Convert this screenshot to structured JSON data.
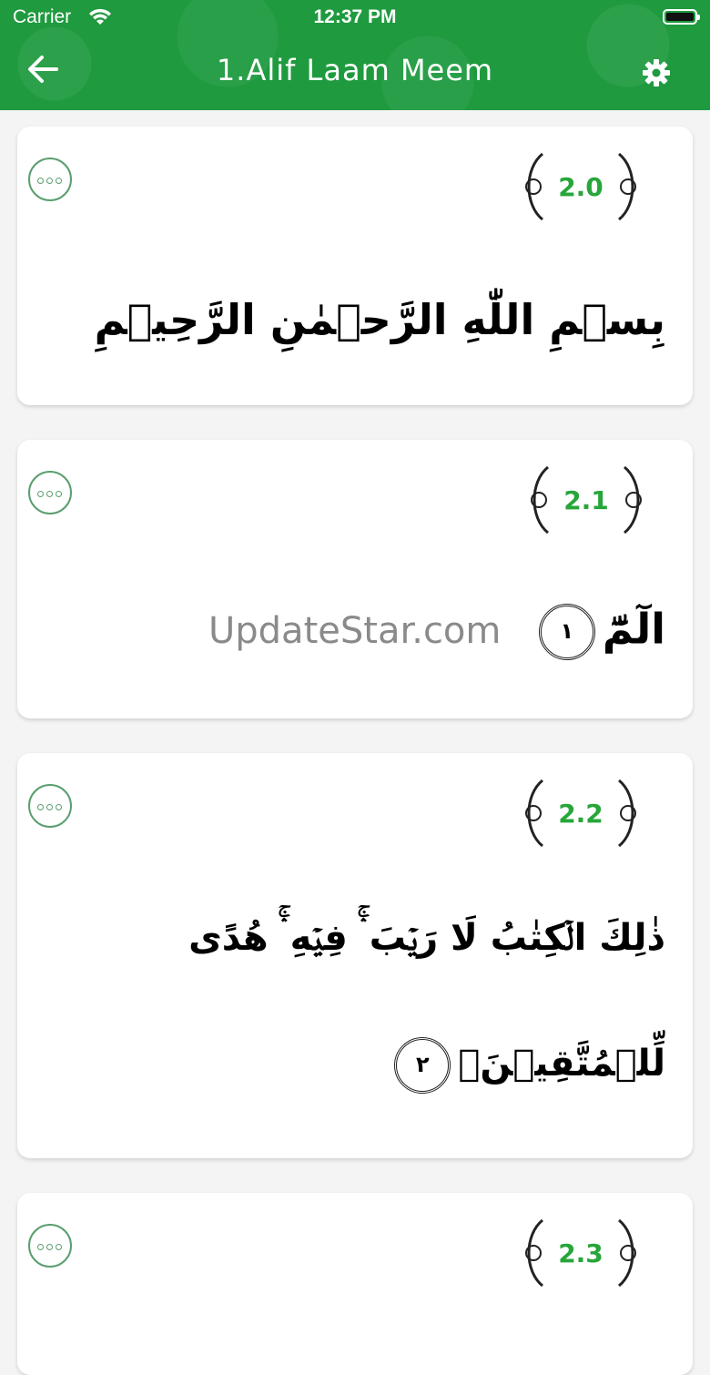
{
  "status_bar": {
    "carrier": "Carrier",
    "time": "12:37 PM"
  },
  "header": {
    "title": "1.Alif Laam Meem",
    "back_icon": "arrow-left-icon",
    "settings_icon": "gear-icon"
  },
  "colors": {
    "header_green": "#1f9a3f",
    "ayah_number_green": "#27a63a",
    "more_button_outline": "#5a9e6f"
  },
  "verses": [
    {
      "number": "2.0",
      "line1": "بِسۡمِ اللّٰهِ الرَّحۡمٰنِ الرَّحِيۡمِ",
      "line2": "",
      "ayah_mark": ""
    },
    {
      "number": "2.1",
      "line1": "الٓمّٓ",
      "line2": "",
      "ayah_mark": "١"
    },
    {
      "number": "2.2",
      "line1": "ذٰلِكَ الۡكِتٰبُ لَا رَيۡبَ ۛۚ فِيۡهِ ۛۚ هُدًى",
      "line2": "لِّلۡمُتَّقِيۡنَۙ",
      "ayah_mark": "٢"
    },
    {
      "number": "2.3"
    }
  ],
  "watermark": "UpdateStar.com"
}
